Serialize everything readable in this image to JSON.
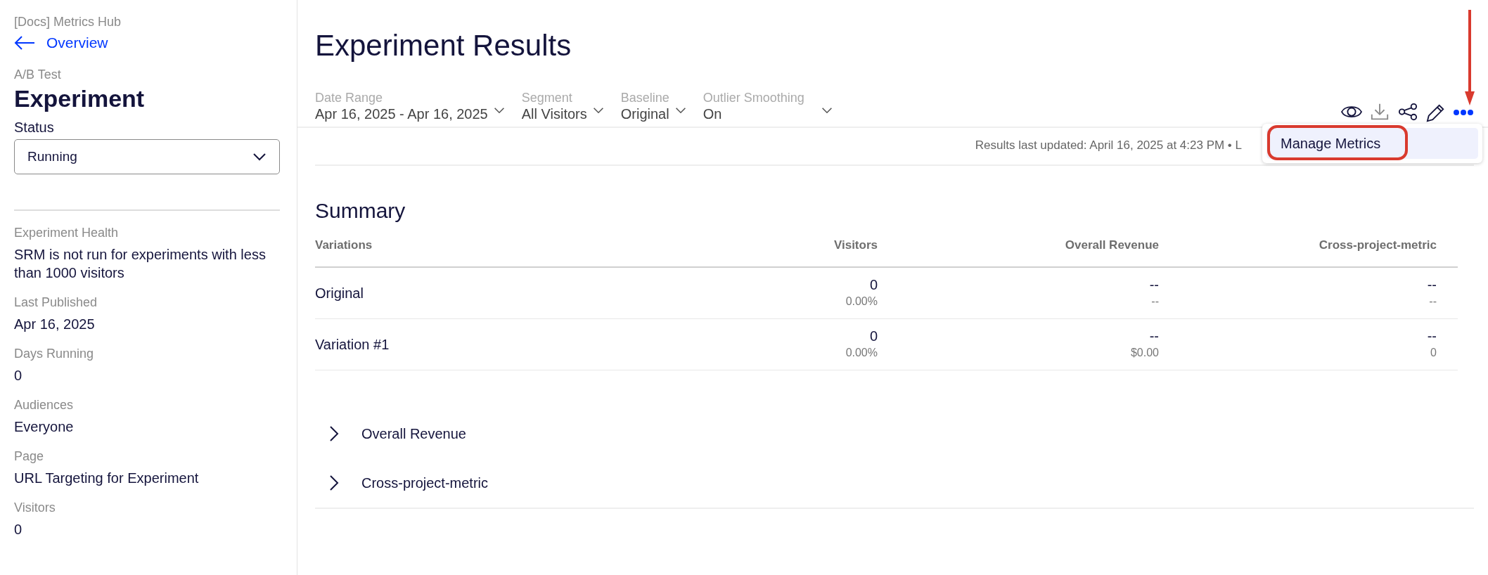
{
  "sidebar": {
    "project": "[Docs] Metrics Hub",
    "back_link": "Overview",
    "type_label": "A/B Test",
    "title": "Experiment",
    "status": {
      "label": "Status",
      "value": "Running"
    },
    "details": [
      {
        "label": "Experiment Health",
        "value": "SRM is not run for experiments with less than 1000 visitors"
      },
      {
        "label": "Last Published",
        "value": "Apr 16, 2025"
      },
      {
        "label": "Days Running",
        "value": "0"
      },
      {
        "label": "Audiences",
        "value": "Everyone"
      },
      {
        "label": "Page",
        "value": "URL Targeting for Experiment"
      },
      {
        "label": "Visitors",
        "value": "0"
      }
    ]
  },
  "header": {
    "title": "Experiment Results",
    "filters": [
      {
        "label": "Date Range",
        "value": "Apr 16, 2025 - Apr 16, 2025"
      },
      {
        "label": "Segment",
        "value": "All Visitors"
      },
      {
        "label": "Baseline",
        "value": "Original"
      },
      {
        "label": "Outlier Smoothing",
        "value": "On"
      }
    ],
    "toolbar": [
      {
        "kind": "view",
        "disabled": false
      },
      {
        "kind": "download",
        "disabled": true
      },
      {
        "kind": "share",
        "disabled": false
      },
      {
        "kind": "edit",
        "disabled": false
      }
    ],
    "more_menu": {
      "expanded": true,
      "items": [
        {
          "label": "Manage Metrics",
          "highlighted": true
        }
      ]
    }
  },
  "status_line": "Results last updated: April 16, 2025 at 4:23 PM • L",
  "summary": {
    "title": "Summary",
    "columns": [
      "Variations",
      "Visitors",
      "Overall Revenue",
      "Cross-project-metric"
    ],
    "rows": [
      {
        "cells": [
          {
            "value": "Original"
          },
          {
            "value": "0",
            "sub": "0.00%"
          },
          {
            "value": "--",
            "sub": "--"
          },
          {
            "value": "--",
            "sub": "--"
          }
        ]
      },
      {
        "cells": [
          {
            "value": "Variation #1"
          },
          {
            "value": "0",
            "sub": "0.00%"
          },
          {
            "value": "--",
            "sub": "$0.00"
          },
          {
            "value": "--",
            "sub": "0"
          }
        ]
      }
    ]
  },
  "metrics": [
    {
      "label": "Overall Revenue",
      "expanded": false
    },
    {
      "label": "Cross-project-metric",
      "expanded": false
    }
  ]
}
